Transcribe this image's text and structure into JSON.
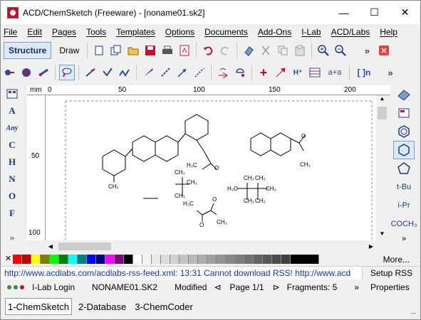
{
  "window": {
    "title": "ACD/ChemSketch (Freeware) - [noname01.sk2]",
    "controls": {
      "minimize": "—",
      "maximize": "☐",
      "close": "✕"
    }
  },
  "menu": [
    "File",
    "Edit",
    "Pages",
    "Tools",
    "Templates",
    "Options",
    "Documents",
    "Add-Ons",
    "I-Lab",
    "ACD/Labs",
    "Help"
  ],
  "toolbar1": {
    "structure_label": "Structure",
    "draw_label": "Draw"
  },
  "toolbar2": {
    "hplus_label": "H⁺",
    "atoa_label": "a+a",
    "bracket_label": "[ ]n"
  },
  "left_atoms": [
    "A",
    "Any",
    "C",
    "H",
    "N",
    "O",
    "F"
  ],
  "right_tools": [
    "t-Bu",
    "i-Pr",
    "COCH₃"
  ],
  "ruler": {
    "unit": "mm",
    "top_ticks": [
      "0",
      "50",
      "100",
      "150",
      "200"
    ],
    "left_ticks": [
      "50",
      "100"
    ]
  },
  "canvas": {
    "labels": {
      "ch3_a": "CH₃",
      "ch3_b": "CH₃",
      "ch3_c": "CH₃",
      "ch3_d": "CH₃",
      "h3c_a": "H₃C",
      "h3c_b": "H₃C",
      "h3c_c": "H₃C",
      "ch3_e": "CH₃",
      "ch3_f": "CH₃",
      "ch3_g": "CH₃",
      "ch3_h": "CH₃",
      "ch3_i": "CH₃",
      "ch3_j": "CH₃",
      "o1": "O",
      "o2": "O",
      "o3": "O",
      "o4": "O"
    }
  },
  "palette": {
    "colors": [
      "#ffffff",
      "#ff0000",
      "#c00000",
      "#ffff00",
      "#808000",
      "#00ff00",
      "#008000",
      "#00ffff",
      "#008080",
      "#0000ff",
      "#000080",
      "#ff00ff",
      "#800080",
      "#000000",
      "#ffffff",
      "#f4f4f4",
      "#e8e8e8",
      "#dcdcdc",
      "#d0d0d0",
      "#c4c4c4",
      "#b8b8b8",
      "#acacac",
      "#a0a0a0",
      "#949494",
      "#888888",
      "#7c7c7c",
      "#707070",
      "#646464",
      "#585858",
      "#4c4c4c",
      "#404040",
      "#000000"
    ],
    "more_label": "More..."
  },
  "rss": {
    "text": "http://www.acdlabs.com/acdlabs-rss-feed.xml: 13:31 Cannot download RSS! http://www.acd",
    "setup_label": "Setup RSS"
  },
  "status": {
    "login": "I-Lab Login",
    "file": "NONAME01.SK2",
    "modified": "Modified",
    "page": "Page 1/1",
    "fragments": "Fragments: 5",
    "more": "»",
    "properties": "Properties"
  },
  "tabs": [
    "1-ChemSketch",
    "2-Database",
    "3-ChemCoder"
  ]
}
